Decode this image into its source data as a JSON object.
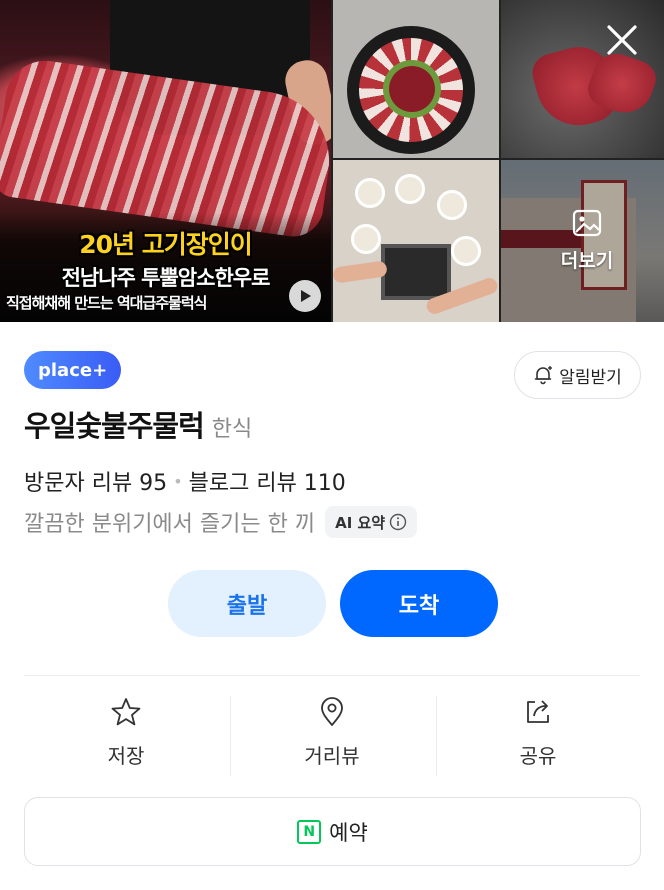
{
  "gallery": {
    "main_caption_line1": "20년 고기장인이",
    "main_caption_line2": "전남나주 투뿔암소한우로",
    "main_caption_line3": "직접해채해 만드는 역대급주물럭식",
    "more_label": "더보기"
  },
  "place": {
    "badge": "place+",
    "notify_label": "알림받기",
    "name": "우일숯불주물럭",
    "category": "한식",
    "visitor_reviews": "방문자 리뷰 95",
    "blog_reviews": "블로그 리뷰 110",
    "summary": "깔끔한 분위기에서 즐기는 한 끼",
    "ai_summary_label": "AI 요약"
  },
  "route": {
    "start_label": "출발",
    "arrive_label": "도착"
  },
  "actions": {
    "save_label": "저장",
    "streetview_label": "거리뷰",
    "share_label": "공유"
  },
  "reserve_label": "예약",
  "colors": {
    "brand_blue": "#0068ff",
    "light_blue": "#e3f0fe",
    "naver_green": "#03c75a"
  }
}
